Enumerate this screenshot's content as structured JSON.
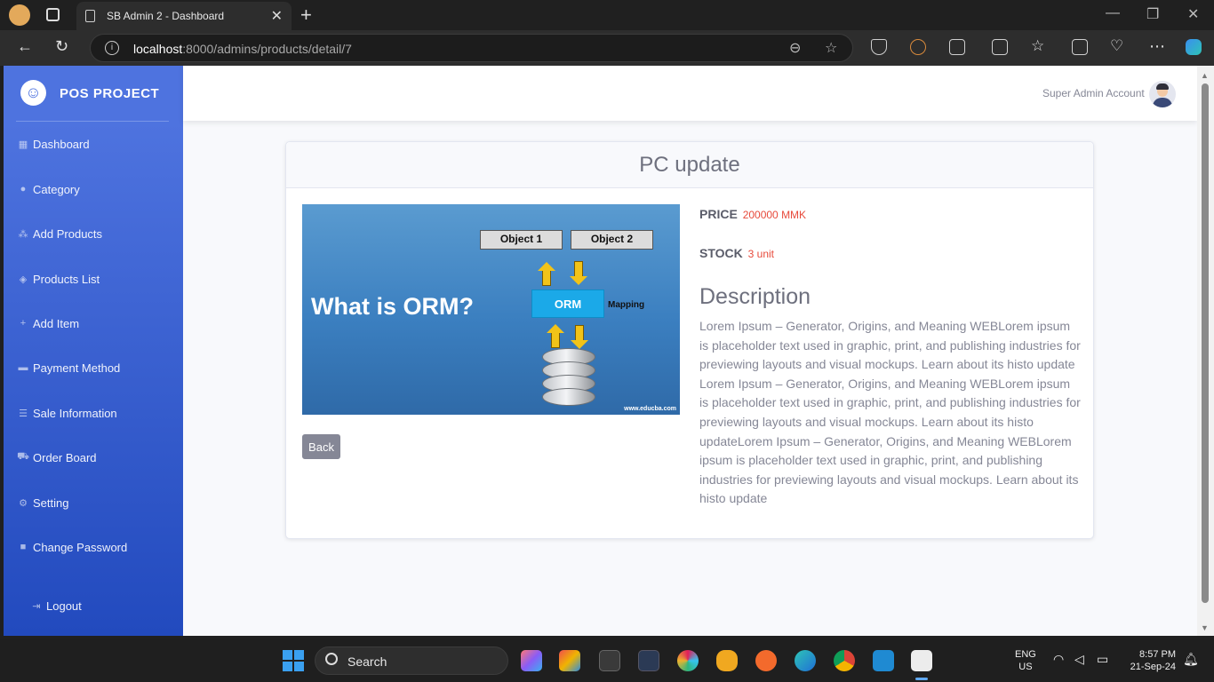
{
  "browser": {
    "tab_title": "SB Admin 2 - Dashboard",
    "url_host": "localhost",
    "url_rest": ":8000/admins/products/detail/7"
  },
  "sidebar": {
    "brand": "POS PROJECT",
    "items": [
      {
        "label": "Dashboard",
        "icon": "table-icon"
      },
      {
        "label": "Category",
        "icon": "circle-icon"
      },
      {
        "label": "Add Products",
        "icon": "sitemap-icon"
      },
      {
        "label": "Products List",
        "icon": "layers-icon"
      },
      {
        "label": "Add Item",
        "icon": "plus-icon"
      },
      {
        "label": "Payment Method",
        "icon": "card-icon"
      },
      {
        "label": "Sale Information",
        "icon": "list-icon"
      },
      {
        "label": "Order Board",
        "icon": "cart-icon"
      },
      {
        "label": "Setting",
        "icon": "gear-icon"
      },
      {
        "label": "Change Password",
        "icon": "lock-icon"
      }
    ],
    "logout": "Logout"
  },
  "topbar": {
    "user_name": "Super Admin Account"
  },
  "product": {
    "title": "PC update",
    "price_label": "PRICE",
    "price_value": "200000 MMK",
    "stock_label": "STOCK",
    "stock_value": "3 unit",
    "description_title": "Description",
    "description": "Lorem Ipsum – Generator, Origins, and Meaning WEBLorem ipsum is placeholder text used in graphic, print, and publishing industries for previewing layouts and visual mockups. Learn about its histo update Lorem Ipsum – Generator, Origins, and Meaning WEBLorem ipsum is placeholder text used in graphic, print, and publishing industries for previewing layouts and visual mockups. Learn about its histo updateLorem Ipsum – Generator, Origins, and Meaning WEBLorem ipsum is placeholder text used in graphic, print, and publishing industries for previewing layouts and visual mockups. Learn about its histo update",
    "back_label": "Back",
    "image": {
      "heading": "What is ORM?",
      "object1": "Object 1",
      "object2": "Object 2",
      "orm": "ORM",
      "mapping": "Mapping",
      "credit": "www.educba.com"
    }
  },
  "taskbar": {
    "search_label": "Search",
    "lang": "ENG",
    "region": "US",
    "time": "8:57 PM",
    "date": "21-Sep-24"
  },
  "colors": {
    "sidebar_start": "#4e73df",
    "sidebar_end": "#224abe",
    "value_red": "#e74a3b",
    "back_button": "#858796"
  }
}
